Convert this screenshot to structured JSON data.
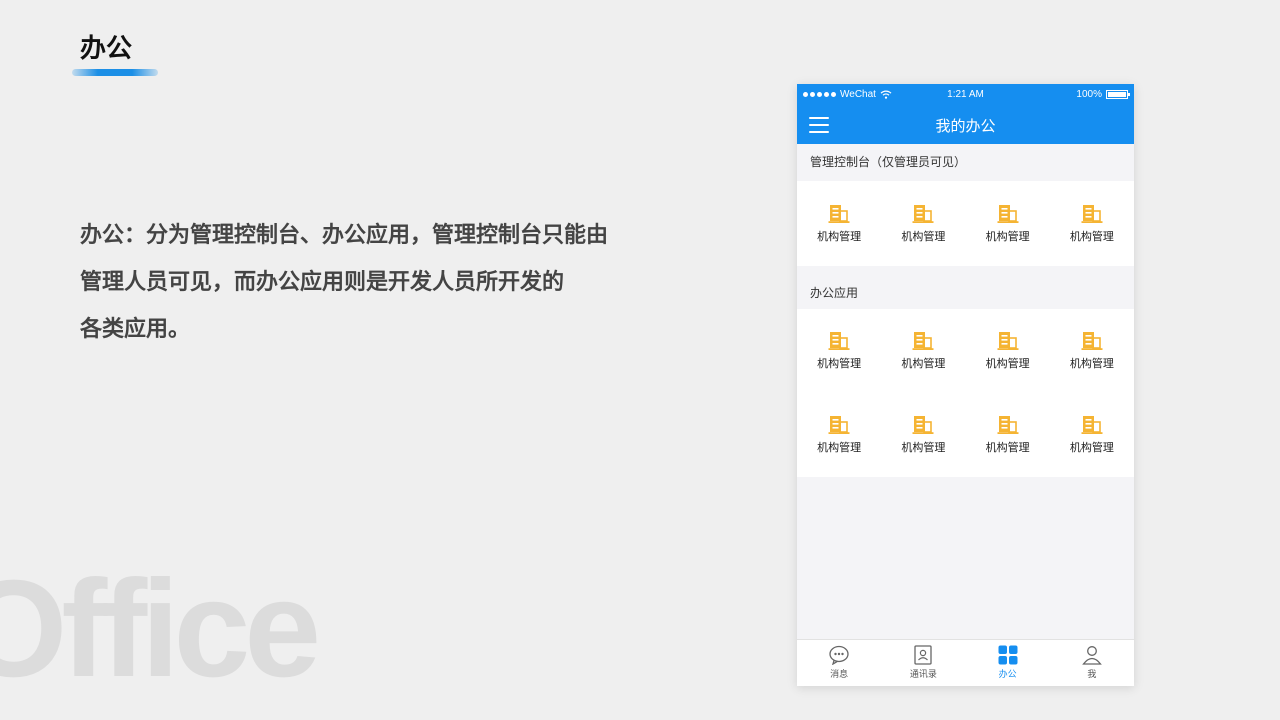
{
  "slide": {
    "title": "办公",
    "description_lines": [
      "办公：分为管理控制台、办公应用，管理控制台只能由",
      "管理人员可见，而办公应用则是开发人员所开发的",
      "各类应用。"
    ],
    "watermark": "Office",
    "accent_color": "#1c8fe6"
  },
  "phone": {
    "status_bar": {
      "carrier": "WeChat",
      "time": "1:21 AM",
      "battery": "100%"
    },
    "nav": {
      "title": "我的办公",
      "menu_icon": "hamburger-menu-icon"
    },
    "sections": [
      {
        "title": "管理控制台（仅管理员可见）",
        "items": [
          "机构管理",
          "机构管理",
          "机构管理",
          "机构管理"
        ]
      },
      {
        "title": "办公应用",
        "items": [
          "机构管理",
          "机构管理",
          "机构管理",
          "机构管理",
          "机构管理",
          "机构管理",
          "机构管理",
          "机构管理"
        ]
      }
    ],
    "item_icon": "building-icon",
    "tabs": [
      {
        "label": "消息",
        "icon": "chat-bubble-icon",
        "active": false
      },
      {
        "label": "通讯录",
        "icon": "contacts-icon",
        "active": false
      },
      {
        "label": "办公",
        "icon": "grid-apps-icon",
        "active": true
      },
      {
        "label": "我",
        "icon": "person-icon",
        "active": false
      }
    ],
    "colors": {
      "brand": "#158ef0",
      "icon_yellow": "#f5b433"
    }
  }
}
